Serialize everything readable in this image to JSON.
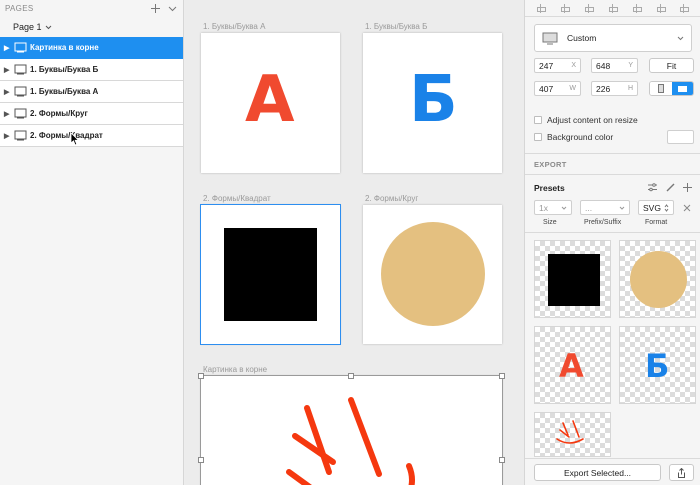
{
  "sidebar": {
    "pages_label": "PAGES",
    "current_page": "Page 1",
    "layers": [
      {
        "label": "Картинка в корне",
        "selected": true
      },
      {
        "label": "1. Буквы/Буква Б",
        "selected": false
      },
      {
        "label": "1. Буквы/Буква А",
        "selected": false
      },
      {
        "label": "2. Формы/Круг",
        "selected": false
      },
      {
        "label": "2. Формы/Квадрат",
        "selected": false
      }
    ]
  },
  "canvas": {
    "artboards": [
      {
        "label": "1. Буквы/Буква А",
        "letter": "А",
        "letter_color": "#f04a2f"
      },
      {
        "label": "1. Буквы/Буква Б",
        "letter": "Б",
        "letter_color": "#1a82e8"
      },
      {
        "label": "2. Формы/Квадрат",
        "shape": "square",
        "color": "#000000"
      },
      {
        "label": "2. Формы/Круг",
        "shape": "circle",
        "color": "#e4c080"
      },
      {
        "label": "Картинка в корне",
        "shape": "hand-drawing",
        "color": "#f5380f"
      }
    ]
  },
  "inspector": {
    "preset_select": "Custom",
    "x": "247",
    "x_unit": "X",
    "y": "648",
    "y_unit": "Y",
    "fit_label": "Fit",
    "width": "407",
    "width_unit": "W",
    "height": "226",
    "height_unit": "H",
    "adjust_label": "Adjust content on resize",
    "background_label": "Background color",
    "export_title": "EXPORT",
    "presets_label": "Presets",
    "size_value": "1x",
    "prefix_value": "...",
    "format_value": "SVG",
    "size_col": "Size",
    "prefix_col": "Prefix/Suffix",
    "format_col": "Format",
    "export_selected": "Export Selected...",
    "thumbs": [
      "square",
      "circle",
      "А",
      "Б",
      "drawing"
    ]
  },
  "colors": {
    "accent": "#1e8ff0",
    "letter_a": "#f04a2f",
    "letter_b": "#1a82e8",
    "circle": "#e4c080",
    "drawing": "#f5380f"
  }
}
